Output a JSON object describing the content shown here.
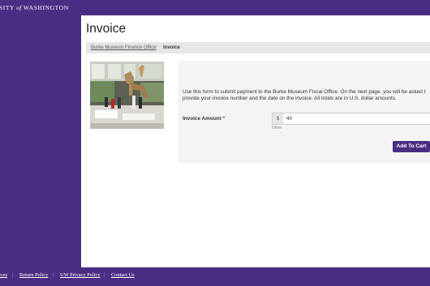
{
  "header": {
    "wordmark_prefix": "SITY",
    "wordmark_of": "of",
    "wordmark_suffix": "WASHINGTON"
  },
  "page": {
    "title": "Invoice"
  },
  "breadcrumb": {
    "parent": "Burke Museum Finance Office",
    "separator": "/",
    "current": "Invoice"
  },
  "form": {
    "intro": "Use this form to submit payment to the Burke Museum Fiscal Office. On the next page, you will be asked t provide your invoice number and the date on the invoice. All totals are in U.S. dollar amounts.",
    "amount_label": "Invoice Amount",
    "required_mark": "*",
    "currency_symbol": "$",
    "amount_value": "40",
    "amount_help": "Other",
    "submit_label": "Add To Cart"
  },
  "footer": {
    "links": [
      "ices",
      "Return Policy",
      "UW Privacy Policy",
      "Contact Us"
    ],
    "separator": "|"
  },
  "colors": {
    "brand_purple": "#4b2e83",
    "required_red": "#c8102e"
  }
}
